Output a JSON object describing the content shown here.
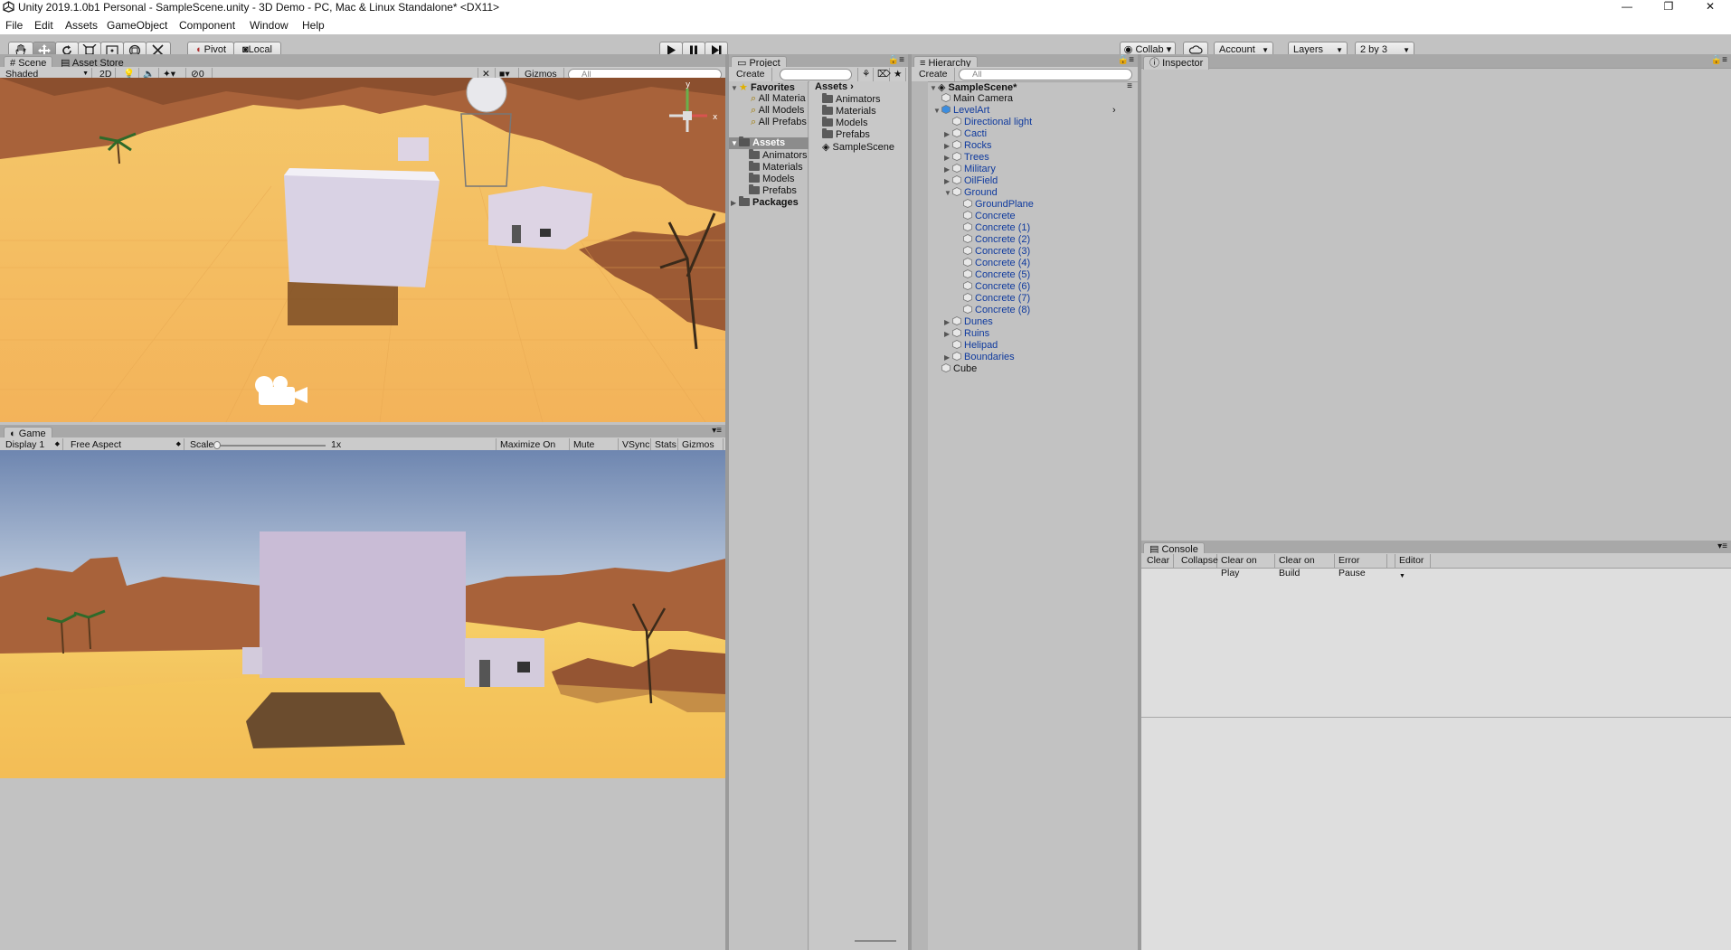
{
  "window": {
    "title": "Unity 2019.1.0b1 Personal - SampleScene.unity - 3D Demo - PC, Mac & Linux Standalone* <DX11>",
    "controls": [
      "—",
      "❐",
      "✕"
    ]
  },
  "menu": [
    "File",
    "Edit",
    "Assets",
    "GameObject",
    "Component",
    "Window",
    "Help"
  ],
  "toolbar": {
    "tools": [
      "hand-tool",
      "move-tool",
      "rotate-tool",
      "scale-tool",
      "rect-tool",
      "transform-tool",
      "custom-tool"
    ],
    "pivot_label": "Pivot",
    "local_label": "Local",
    "collab_label": "Collab ▾",
    "account_label": "Account",
    "layers_label": "Layers",
    "layout_label": "2 by 3"
  },
  "scene": {
    "tab": "Scene",
    "tab2": "Asset Store",
    "shading": "Shaded",
    "mode2d": "2D",
    "hidden_count": "0",
    "gizmos": "Gizmos",
    "search_placeholder": "All",
    "gizmo_labels": {
      "y": "y",
      "x": "x"
    }
  },
  "game": {
    "tab": "Game",
    "display": "Display 1",
    "aspect": "Free Aspect",
    "scale_label": "Scale",
    "scale_value": "1x",
    "scale_fraction": 0.0,
    "maximize": "Maximize On Play",
    "mute": "Mute Audio",
    "vsync": "VSync",
    "stats": "Stats",
    "gizmos": "Gizmos"
  },
  "project": {
    "tab": "Project",
    "create": "Create",
    "favorites_label": "Favorites",
    "favorites": [
      "All Materia",
      "All Models",
      "All Prefabs"
    ],
    "assets_label": "Assets",
    "asset_folders": [
      "Animators",
      "Materials",
      "Models",
      "Prefabs"
    ],
    "packages_label": "Packages",
    "breadcrumb": "Assets",
    "contents": [
      "Animators",
      "Materials",
      "Models",
      "Prefabs",
      "SampleScene"
    ]
  },
  "hierarchy": {
    "tab": "Hierarchy",
    "create": "Create",
    "search_placeholder": "All",
    "scene": "SampleScene*",
    "items": [
      {
        "label": "Main Camera",
        "indent": 1,
        "arrow": "",
        "blue": false,
        "icon": "cube"
      },
      {
        "label": "LevelArt",
        "indent": 1,
        "arrow": "▼",
        "blue": true,
        "icon": "prefab"
      },
      {
        "label": "Directional light",
        "indent": 2,
        "arrow": "",
        "blue": true,
        "icon": "cube"
      },
      {
        "label": "Cacti",
        "indent": 2,
        "arrow": "▶",
        "blue": true,
        "icon": "cube"
      },
      {
        "label": "Rocks",
        "indent": 2,
        "arrow": "▶",
        "blue": true,
        "icon": "cube"
      },
      {
        "label": "Trees",
        "indent": 2,
        "arrow": "▶",
        "blue": true,
        "icon": "cube"
      },
      {
        "label": "Military",
        "indent": 2,
        "arrow": "▶",
        "blue": true,
        "icon": "cube"
      },
      {
        "label": "OilField",
        "indent": 2,
        "arrow": "▶",
        "blue": true,
        "icon": "cube"
      },
      {
        "label": "Ground",
        "indent": 2,
        "arrow": "▼",
        "blue": true,
        "icon": "cube"
      },
      {
        "label": "GroundPlane",
        "indent": 3,
        "arrow": "",
        "blue": true,
        "icon": "cube"
      },
      {
        "label": "Concrete",
        "indent": 3,
        "arrow": "",
        "blue": true,
        "icon": "cube"
      },
      {
        "label": "Concrete (1)",
        "indent": 3,
        "arrow": "",
        "blue": true,
        "icon": "cube"
      },
      {
        "label": "Concrete (2)",
        "indent": 3,
        "arrow": "",
        "blue": true,
        "icon": "cube"
      },
      {
        "label": "Concrete (3)",
        "indent": 3,
        "arrow": "",
        "blue": true,
        "icon": "cube"
      },
      {
        "label": "Concrete (4)",
        "indent": 3,
        "arrow": "",
        "blue": true,
        "icon": "cube"
      },
      {
        "label": "Concrete (5)",
        "indent": 3,
        "arrow": "",
        "blue": true,
        "icon": "cube"
      },
      {
        "label": "Concrete (6)",
        "indent": 3,
        "arrow": "",
        "blue": true,
        "icon": "cube"
      },
      {
        "label": "Concrete (7)",
        "indent": 3,
        "arrow": "",
        "blue": true,
        "icon": "cube"
      },
      {
        "label": "Concrete (8)",
        "indent": 3,
        "arrow": "",
        "blue": true,
        "icon": "cube"
      },
      {
        "label": "Dunes",
        "indent": 2,
        "arrow": "▶",
        "blue": true,
        "icon": "cube"
      },
      {
        "label": "Ruins",
        "indent": 2,
        "arrow": "▶",
        "blue": true,
        "icon": "cube"
      },
      {
        "label": "Helipad",
        "indent": 2,
        "arrow": "",
        "blue": true,
        "icon": "cube"
      },
      {
        "label": "Boundaries",
        "indent": 2,
        "arrow": "▶",
        "blue": true,
        "icon": "cube"
      },
      {
        "label": "Cube",
        "indent": 1,
        "arrow": "",
        "blue": false,
        "icon": "cube"
      }
    ]
  },
  "inspector": {
    "tab": "Inspector"
  },
  "console": {
    "tab": "Console",
    "buttons": [
      "Clear",
      "Collapse",
      "Clear on Play",
      "Clear on Build",
      "Error Pause",
      "Editor"
    ]
  },
  "colors": {
    "editor_bg": "#c2c2c2",
    "sand": "#f2b85a",
    "rock": "#a8623a",
    "sky_top": "#6e86b0",
    "sky_bottom": "#c9d5e4",
    "cube": "#c9bcd6",
    "blue_text": "#0f3a9e"
  }
}
